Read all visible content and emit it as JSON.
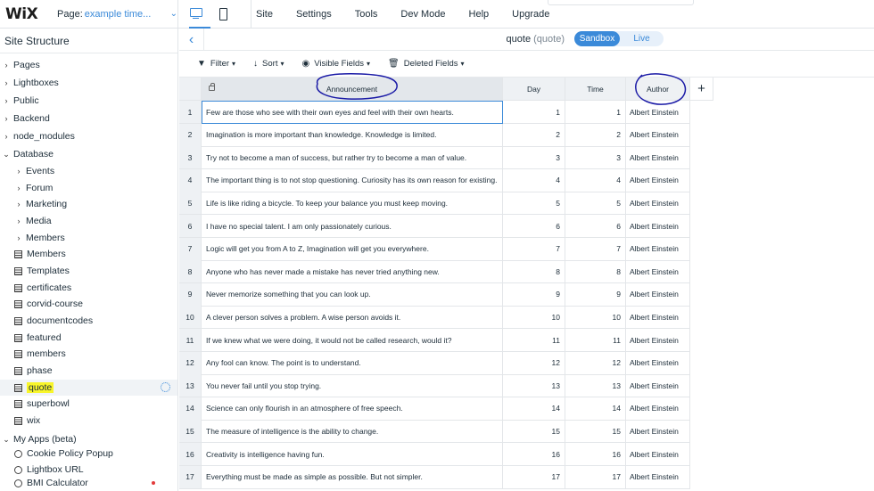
{
  "topbar": {
    "logo": "WiX",
    "page_label": "Page:",
    "page_value": "example time...",
    "menu": [
      "Site",
      "Settings",
      "Tools",
      "Dev Mode",
      "Help",
      "Upgrade"
    ]
  },
  "sidebar": {
    "title": "Site Structure",
    "items": [
      {
        "label": "Pages",
        "indent": 0,
        "kind": "folder"
      },
      {
        "label": "Lightboxes",
        "indent": 0,
        "kind": "folder"
      },
      {
        "label": "Public",
        "indent": 0,
        "kind": "folder"
      },
      {
        "label": "Backend",
        "indent": 0,
        "kind": "folder"
      },
      {
        "label": "node_modules",
        "indent": 0,
        "kind": "folder"
      },
      {
        "label": "Database",
        "indent": 0,
        "kind": "open"
      },
      {
        "label": "Events",
        "indent": 1,
        "kind": "folder"
      },
      {
        "label": "Forum",
        "indent": 1,
        "kind": "folder"
      },
      {
        "label": "Marketing",
        "indent": 1,
        "kind": "folder"
      },
      {
        "label": "Media",
        "indent": 1,
        "kind": "folder"
      },
      {
        "label": "Members",
        "indent": 1,
        "kind": "folder"
      },
      {
        "label": "Members",
        "indent": 1,
        "kind": "table"
      },
      {
        "label": "Templates",
        "indent": 1,
        "kind": "table"
      },
      {
        "label": "certificates",
        "indent": 1,
        "kind": "table"
      },
      {
        "label": "corvid-course",
        "indent": 1,
        "kind": "table"
      },
      {
        "label": "documentcodes",
        "indent": 1,
        "kind": "table"
      },
      {
        "label": "featured",
        "indent": 1,
        "kind": "table"
      },
      {
        "label": "members",
        "indent": 1,
        "kind": "table"
      },
      {
        "label": "phase",
        "indent": 1,
        "kind": "table"
      },
      {
        "label": "quote",
        "indent": 1,
        "kind": "table"
      },
      {
        "label": "superbowl",
        "indent": 1,
        "kind": "table"
      },
      {
        "label": "wix",
        "indent": 1,
        "kind": "table"
      },
      {
        "label": "My Apps (beta)",
        "indent": 0,
        "kind": "open"
      },
      {
        "label": "Cookie Policy Popup",
        "indent": 1,
        "kind": "app"
      },
      {
        "label": "Lightbox URL",
        "indent": 1,
        "kind": "app"
      },
      {
        "label": "BMI Calculator",
        "indent": 1,
        "kind": "app"
      }
    ]
  },
  "collection": {
    "name": "quote",
    "sub": "(quote)",
    "mode_on": "Sandbox",
    "mode_off": "Live"
  },
  "toolbar": {
    "filter": "Filter",
    "sort": "Sort",
    "visible_fields": "Visible Fields",
    "deleted_fields": "Deleted Fields"
  },
  "table": {
    "headers": [
      "Announcement",
      "Day",
      "Time",
      "Author"
    ],
    "add_symbol": "+",
    "rows": [
      [
        "1",
        "Few are those who see with their own eyes and feel with their own hearts.",
        "1",
        "1",
        "Albert Einstein"
      ],
      [
        "2",
        "Imagination is more important than knowledge. Knowledge is limited.",
        "2",
        "2",
        "Albert Einstein"
      ],
      [
        "3",
        "Try not to become a man of success, but rather try to become a man of value.",
        "3",
        "3",
        "Albert Einstein"
      ],
      [
        "4",
        "The important thing is to not stop questioning. Curiosity has its own reason for existing.",
        "4",
        "4",
        "Albert Einstein"
      ],
      [
        "5",
        "Life is like riding a bicycle. To keep your balance you must keep moving.",
        "5",
        "5",
        "Albert Einstein"
      ],
      [
        "6",
        "I have no special talent. I am only passionately curious.",
        "6",
        "6",
        "Albert Einstein"
      ],
      [
        "7",
        "Logic will get you from A to Z, Imagination will get you everywhere.",
        "7",
        "7",
        "Albert Einstein"
      ],
      [
        "8",
        "Anyone who has never made a mistake has never tried anything new.",
        "8",
        "8",
        "Albert Einstein"
      ],
      [
        "9",
        "Never memorize something that you can look up.",
        "9",
        "9",
        "Albert Einstein"
      ],
      [
        "10",
        "A clever person solves a problem. A wise person avoids it.",
        "10",
        "10",
        "Albert Einstein"
      ],
      [
        "11",
        "If we knew what we were doing, it would not be called research, would it?",
        "11",
        "11",
        "Albert Einstein"
      ],
      [
        "12",
        "Any fool can know. The point is to understand.",
        "12",
        "12",
        "Albert Einstein"
      ],
      [
        "13",
        "You never fail until you stop trying.",
        "13",
        "13",
        "Albert Einstein"
      ],
      [
        "14",
        "Science can only flourish in an atmosphere of free speech.",
        "14",
        "14",
        "Albert Einstein"
      ],
      [
        "15",
        "The measure of intelligence is the ability to change.",
        "15",
        "15",
        "Albert Einstein"
      ],
      [
        "16",
        "Creativity is intelligence having fun.",
        "16",
        "16",
        "Albert Einstein"
      ],
      [
        "17",
        "Everything must be made as simple as possible. But not simpler.",
        "17",
        "17",
        "Albert Einstein"
      ]
    ]
  },
  "colors": {
    "accent": "#3b8ad9",
    "highlight": "#f8f52a",
    "annotation_ink": "#1a1aa6"
  }
}
